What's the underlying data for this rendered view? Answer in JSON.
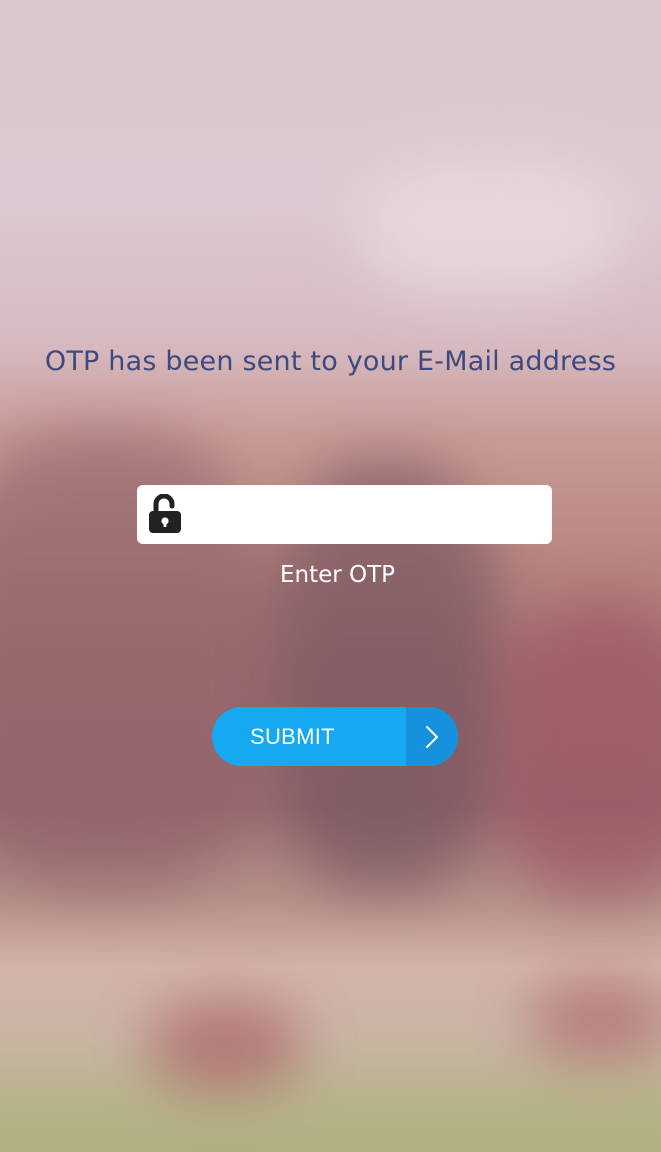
{
  "headline": "OTP has been sent to your E-Mail address",
  "otp_field": {
    "value": "",
    "placeholder": "",
    "label": "Enter OTP",
    "icon": "unlock-icon"
  },
  "submit": {
    "label": "SUBMIT",
    "icon": "chevron-right-icon"
  },
  "colors": {
    "headline": "#3b4a80",
    "button": "#16a9f2",
    "button_arrow_bg": "#1591dd",
    "label": "#ffffff"
  }
}
